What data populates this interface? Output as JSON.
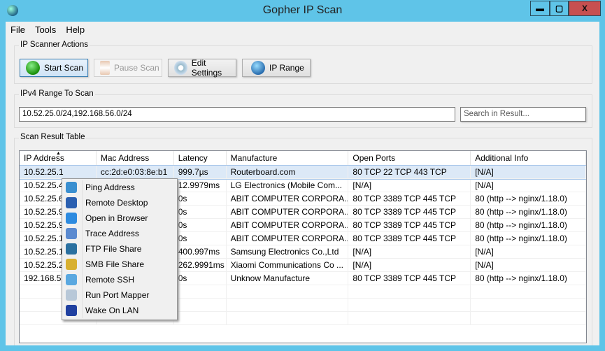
{
  "window": {
    "title": "Gopher IP Scan",
    "minimize": "▬",
    "maximize": "▢",
    "close": "X"
  },
  "menu": [
    "File",
    "Tools",
    "Help"
  ],
  "actions": {
    "label": "IP Scanner Actions",
    "start": "Start Scan",
    "pause": "Pause Scan",
    "settings": "Edit Settings",
    "range": "IP Range"
  },
  "range": {
    "label": "IPv4 Range To Scan",
    "value": "10.52.25.0/24,192.168.56.0/24",
    "search_placeholder": "Search in Result..."
  },
  "results": {
    "label": "Scan Result Table",
    "columns": [
      "IP Address",
      "Mac Address",
      "Latency",
      "Manufacture",
      "Open Ports",
      "Additional Info"
    ],
    "rows": [
      [
        "10.52.25.1",
        "cc:2d:e0:03:8e:b1",
        "999.7µs",
        "Routerboard.com",
        "80 TCP 22 TCP 443 TCP",
        "[N/A]"
      ],
      [
        "10.52.25.40",
        "",
        "12.9979ms",
        "LG Electronics (Mobile Com...",
        "[N/A]",
        "[N/A]"
      ],
      [
        "10.52.25.60",
        "",
        "0s",
        "ABIT COMPUTER CORPORA...",
        "80 TCP 3389 TCP 445 TCP",
        "80 (http --> nginx/1.18.0)"
      ],
      [
        "10.52.25.93",
        "",
        "0s",
        "ABIT COMPUTER CORPORA...",
        "80 TCP 3389 TCP 445 TCP",
        "80 (http --> nginx/1.18.0)"
      ],
      [
        "10.52.25.95",
        "",
        "0s",
        "ABIT COMPUTER CORPORA...",
        "80 TCP 3389 TCP 445 TCP",
        "80 (http --> nginx/1.18.0)"
      ],
      [
        "10.52.25.10",
        "",
        "0s",
        "ABIT COMPUTER CORPORA...",
        "80 TCP 3389 TCP 445 TCP",
        "80 (http --> nginx/1.18.0)"
      ],
      [
        "10.52.25.17",
        "",
        "400.997ms",
        "Samsung Electronics Co.,Ltd",
        "[N/A]",
        "[N/A]"
      ],
      [
        "10.52.25.24",
        "",
        "262.9991ms",
        "Xiaomi Communications Co ...",
        "[N/A]",
        "[N/A]"
      ],
      [
        "192.168.56",
        "",
        "0s",
        "Unknow Manufacture",
        "80 TCP 3389 TCP 445 TCP",
        "80 (http --> nginx/1.18.0)"
      ]
    ]
  },
  "context_menu": [
    {
      "label": "Ping Address",
      "icon": "ping-icon",
      "color": "#3a8fd0"
    },
    {
      "label": "Remote Desktop",
      "icon": "remote-desktop-icon",
      "color": "#2a5fb0"
    },
    {
      "label": "Open in Browser",
      "icon": "browser-icon",
      "color": "#2d8be0"
    },
    {
      "label": "Trace Address",
      "icon": "trace-icon",
      "color": "#5b8ad0"
    },
    {
      "label": "FTP File Share",
      "icon": "ftp-icon",
      "color": "#2a70a0"
    },
    {
      "label": "SMB File Share",
      "icon": "smb-icon",
      "color": "#d8b030"
    },
    {
      "label": "Remote SSH",
      "icon": "ssh-icon",
      "color": "#5aa8e0"
    },
    {
      "label": "Run Port Mapper",
      "icon": "magnifier-icon",
      "color": "#b8c8d8"
    },
    {
      "label": "Wake On LAN",
      "icon": "monitor-icon",
      "color": "#2040a0"
    }
  ]
}
